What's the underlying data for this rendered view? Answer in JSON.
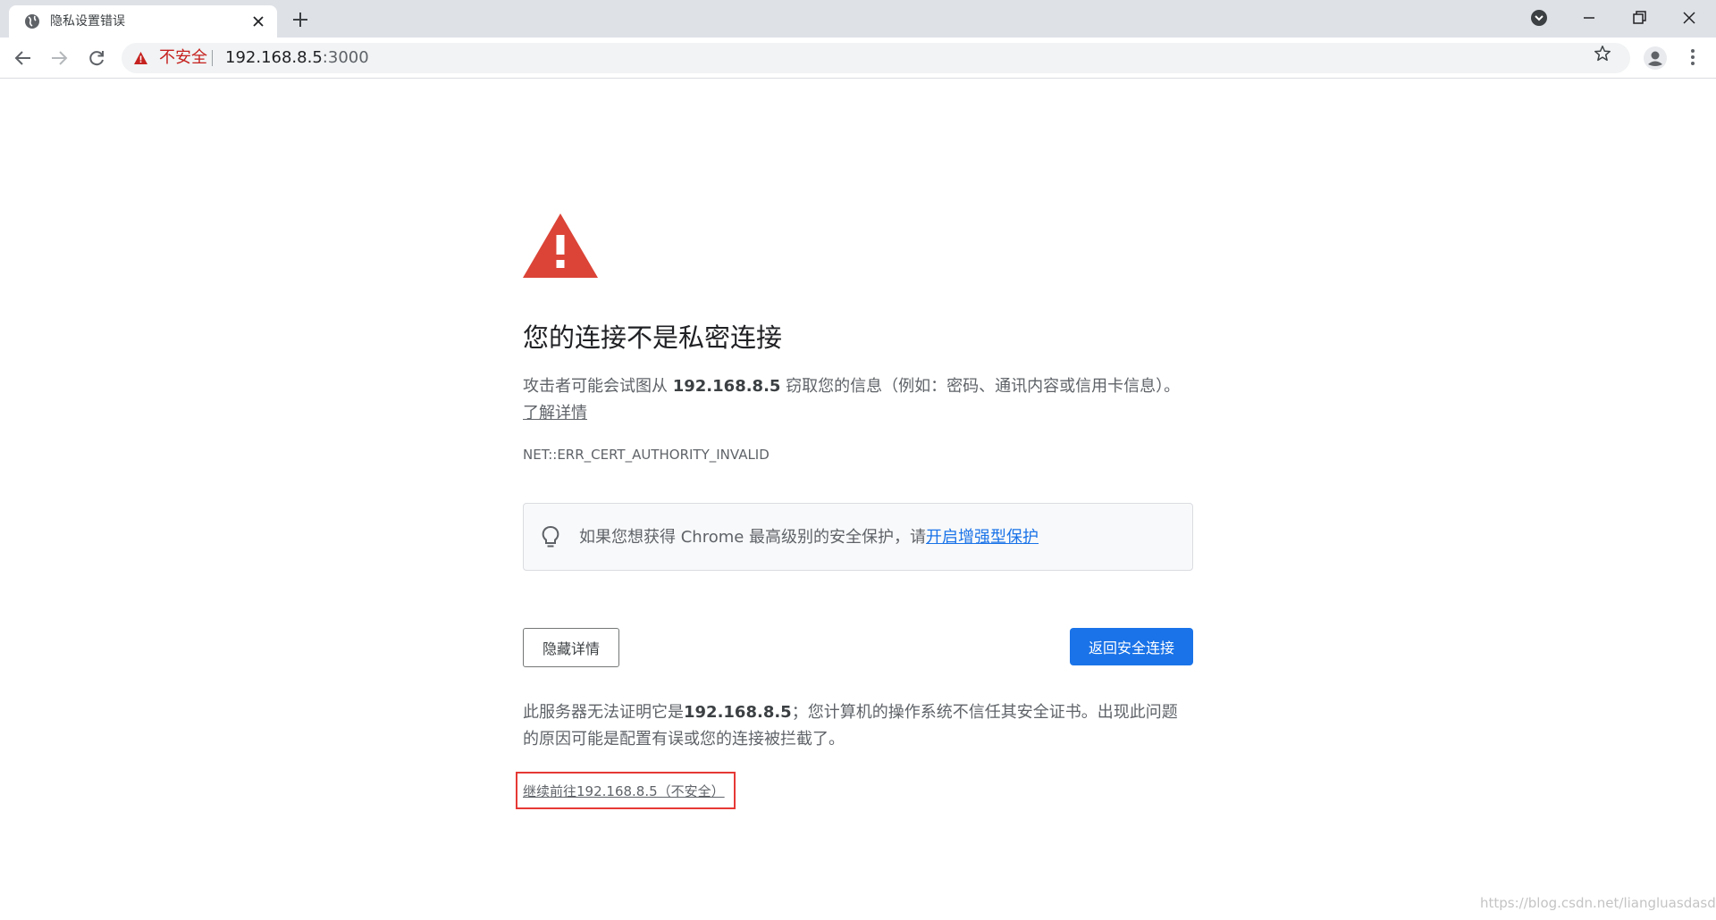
{
  "browser": {
    "tab": {
      "title": "隐私设置错误",
      "favicon": "globe-icon"
    },
    "address_bar": {
      "security_label": "不安全",
      "host": "192.168.8.5",
      "port": ":3000"
    },
    "colors": {
      "insecure_red": "#c5221f",
      "chrome_blue": "#1a73e8"
    }
  },
  "interstitial": {
    "heading": "您的连接不是私密连接",
    "description": {
      "prefix": "攻击者可能会试图从 ",
      "host": "192.168.8.5",
      "suffix": " 窃取您的信息（例如：密码、通讯内容或信用卡信息）。",
      "learn_more": "了解详情"
    },
    "error_code": "NET::ERR_CERT_AUTHORITY_INVALID",
    "tip": {
      "text": "如果您想获得 Chrome 最高级别的安全保护，请",
      "link": "开启增强型保护"
    },
    "buttons": {
      "hide_details": "隐藏详情",
      "back_to_safety": "返回安全连接"
    },
    "details": {
      "prefix": "此服务器无法证明它是",
      "host": "192.168.8.5",
      "suffix": "；您计算机的操作系统不信任其安全证书。出现此问题的原因可能是配置有误或您的连接被拦截了。"
    },
    "proceed_link": "继续前往192.168.8.5（不安全）"
  },
  "watermark": "https://blog.csdn.net/liangluasdasda"
}
